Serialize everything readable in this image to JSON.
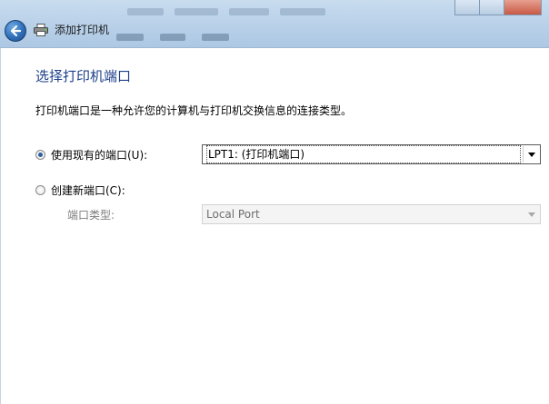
{
  "header": {
    "title": "添加打印机"
  },
  "page": {
    "heading": "选择打印机端口",
    "description": "打印机端口是一种允许您的计算机与打印机交换信息的连接类型。"
  },
  "options": {
    "existing_port_label": "使用现有的端口(U):",
    "existing_port_selected": true,
    "existing_port_value": "LPT1: (打印机端口)",
    "new_port_label": "创建新端口(C):",
    "new_port_selected": false,
    "port_type_label": "端口类型:",
    "port_type_value": "Local Port"
  },
  "colors": {
    "heading": "#1e3f8a",
    "titlebar": "#bcd3ea",
    "disabled_text": "#7d7d7d"
  },
  "icons": {
    "back": "back-arrow-icon",
    "printer": "printer-icon",
    "dropdown": "chevron-down-icon"
  }
}
